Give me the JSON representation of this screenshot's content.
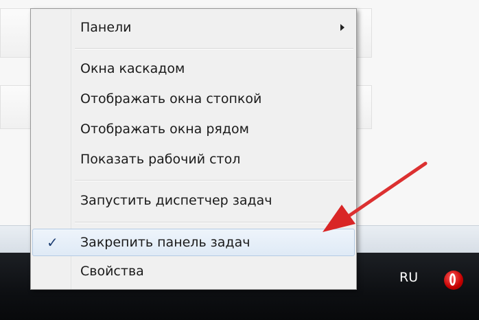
{
  "context_menu": {
    "items": [
      {
        "label": "Панели",
        "has_submenu": true
      },
      {
        "label": "Окна каскадом"
      },
      {
        "label": "Отображать окна стопкой"
      },
      {
        "label": "Отображать окна рядом"
      },
      {
        "label": "Показать рабочий стол"
      },
      {
        "label": "Запустить диспетчер задач"
      },
      {
        "label": "Закрепить панель задач",
        "checked": true,
        "check_glyph": "✓"
      },
      {
        "label": "Свойства"
      }
    ]
  },
  "taskbar": {
    "language": "RU",
    "tray_icon": "opera-icon"
  },
  "colors": {
    "annotation_arrow": "#e02a2a",
    "taskbar": "#0f1114",
    "checked_highlight": "#dfeaf6"
  }
}
